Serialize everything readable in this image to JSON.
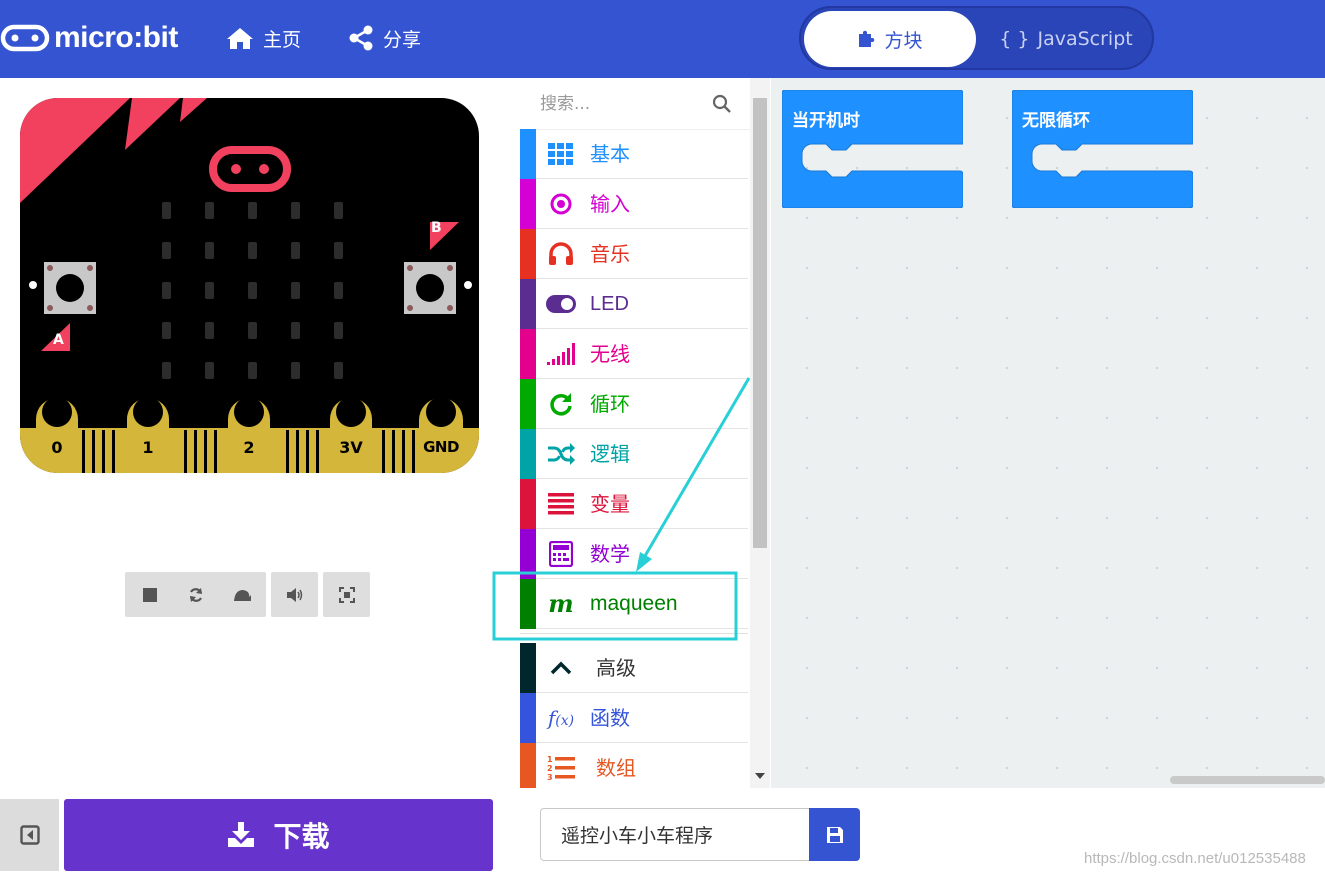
{
  "header": {
    "logo_text": "micro:bit",
    "home_label": "主页",
    "share_label": "分享",
    "tab_blocks": "方块",
    "tab_js_icon": "{ }",
    "tab_js": "JavaScript"
  },
  "simulator": {
    "pin_labels": [
      "0",
      "1",
      "2",
      "3V",
      "GND"
    ],
    "button_a": "A",
    "button_b": "B",
    "controls": [
      "stop-icon",
      "restart-icon",
      "slow-motion-icon",
      "mute-icon",
      "fullscreen-icon"
    ]
  },
  "toolbox": {
    "search_placeholder": "搜索...",
    "categories": [
      {
        "label": "基本",
        "color": "#1e90ff",
        "icon": "grid-icon"
      },
      {
        "label": "输入",
        "color": "#d400d4",
        "icon": "target-icon"
      },
      {
        "label": "音乐",
        "color": "#e63022",
        "icon": "headphones-icon"
      },
      {
        "label": "LED",
        "color": "#5c2d91",
        "icon": "toggle-icon"
      },
      {
        "label": "无线",
        "color": "#e3008c",
        "icon": "signal-icon"
      },
      {
        "label": "循环",
        "color": "#00aa00",
        "icon": "refresh-icon"
      },
      {
        "label": "逻辑",
        "color": "#00a4a6",
        "icon": "shuffle-icon"
      },
      {
        "label": "变量",
        "color": "#dc143c",
        "icon": "list-icon"
      },
      {
        "label": "数学",
        "color": "#9400d3",
        "icon": "calculator-icon"
      },
      {
        "label": "maqueen",
        "color": "#008000",
        "icon": "maqueen-icon"
      },
      {
        "label": "高级",
        "color": "#00272b",
        "icon": "chevron-up-icon"
      },
      {
        "label": "函数",
        "color": "#3455db",
        "icon": "function-icon"
      },
      {
        "label": "数组",
        "color": "#e65722",
        "icon": "numbered-list-icon"
      }
    ]
  },
  "workspace": {
    "blocks": [
      {
        "label": "当开机时",
        "color": "#1e90ff"
      },
      {
        "label": "无限循环",
        "color": "#1e90ff"
      }
    ]
  },
  "bottom": {
    "download_label": "下载",
    "project_name": "遥控小车小车程序",
    "watermark": "https://blog.csdn.net/u012535488"
  }
}
